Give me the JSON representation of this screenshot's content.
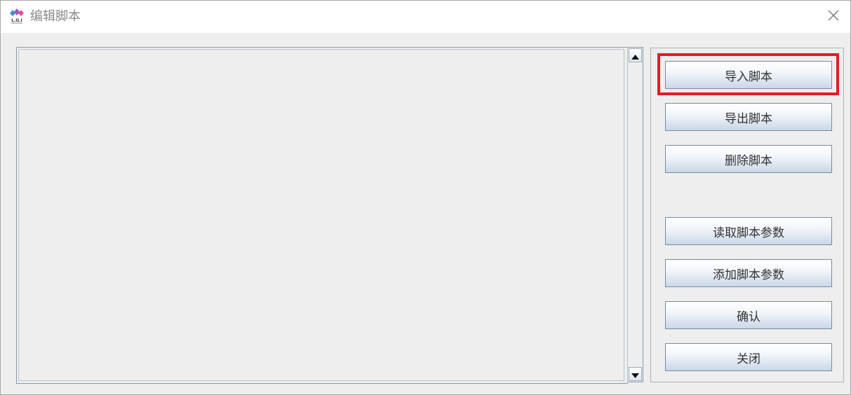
{
  "window": {
    "title": "编辑脚本",
    "app_icon": "lgi-logo-icon",
    "close_icon": "close-icon"
  },
  "editor": {
    "value": "",
    "scroll_up_icon": "triangle-up-icon",
    "scroll_down_icon": "triangle-down-icon"
  },
  "buttons": {
    "import_script": "导入脚本",
    "export_script": "导出脚本",
    "delete_script": "删除脚本",
    "read_params": "读取脚本参数",
    "add_params": "添加脚本参数",
    "confirm": "确认",
    "close": "关闭"
  },
  "colors": {
    "highlight": "#e41b26",
    "window_bg": "#eeeeee",
    "title_text": "#8a8a8a"
  }
}
